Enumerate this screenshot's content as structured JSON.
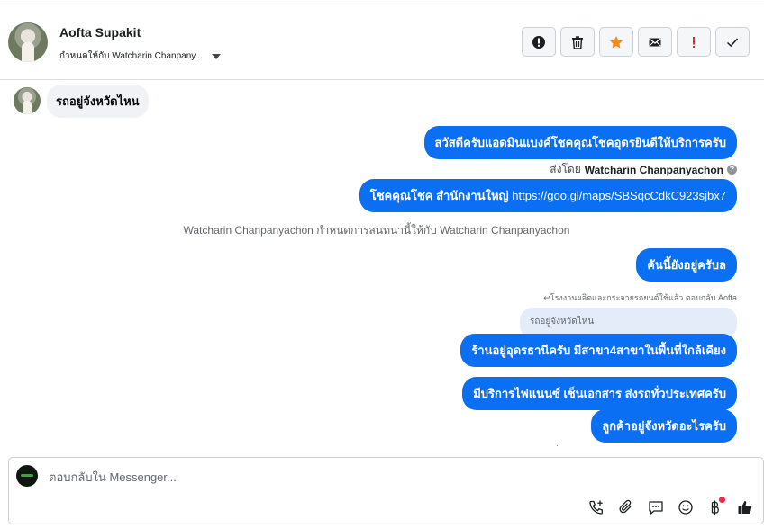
{
  "header": {
    "contact_name": "Aofta Supakit",
    "assigned_text": "กำหนดให้กับ Watcharin Chanpany..."
  },
  "actions": [
    {
      "name": "spam-button",
      "icon": "alert-circle-icon"
    },
    {
      "name": "delete-button",
      "icon": "trash-icon"
    },
    {
      "name": "star-button",
      "icon": "star-icon",
      "color": "#f58b1f"
    },
    {
      "name": "mail-button",
      "icon": "envelope-icon"
    },
    {
      "name": "important-button",
      "icon": "exclamation-icon",
      "color": "#e02d2d"
    },
    {
      "name": "done-button",
      "icon": "check-icon"
    }
  ],
  "messages": {
    "incoming_1": "รถอยู่จังหวัดไหน",
    "out_1": "สวัสดีครับแอดมินแบงค์โชคคุณโชคอุดรยินดีให้บริการครับ",
    "sent_by_label": "ส่งโดย",
    "sent_by_name": "Watcharin Chanpanyachon",
    "out_2_prefix": "โชคคุณโชค สำนักงานใหญ่",
    "out_2_link": "https://goo.gl/maps/SBSqcCdkC923sjbx7",
    "system_note": "Watcharin Chanpanyachon กำหนดการสนทนานี้ให้กับ Watcharin Chanpanyachon",
    "out_3": "คันนี้ยังอยู่ครับล",
    "reply_note": "↩โรงงานผลิตและกระจายรถยนต์ใช้แล้ว ตอบกลับ Aofta",
    "quoted": "รถอยู่จังหวัดไหน",
    "out_4": "ร้านอยู่อุดรธานีครับ มีสาขา4สาขาในพื้นที่ใกล้เคียง",
    "out_5": "มีบริการไฟแนนซ์ เช็นเอกสาร ส่งรถทั่วประเทศครับ",
    "out_6": "ลูกค้าอยู่จังหวัดอะไรครับ"
  },
  "composer": {
    "placeholder": "ตอบกลับใน Messenger..."
  },
  "colors": {
    "bubble_out": "#0b6ff3",
    "bubble_in": "#f0f2f5"
  }
}
